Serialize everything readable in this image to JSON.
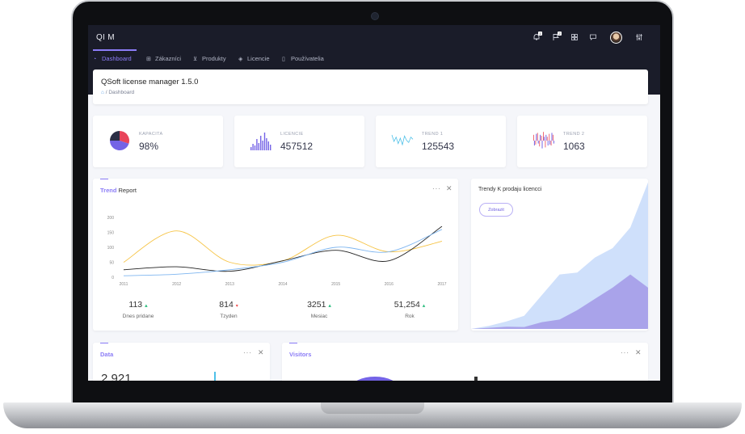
{
  "app": {
    "brand": "QI M"
  },
  "topbar": {
    "icons": [
      "bell-icon",
      "flag-icon",
      "grid-icon",
      "chat-icon",
      "avatar",
      "sliders-icon"
    ],
    "bell_badge": "1",
    "flag_badge": "2"
  },
  "nav": {
    "items": [
      {
        "label": "Dashboard",
        "icon": "gauge-icon",
        "active": true
      },
      {
        "label": "Zákazníci",
        "icon": "grid-icon"
      },
      {
        "label": "Produkty",
        "icon": "cart-icon"
      },
      {
        "label": "Licencie",
        "icon": "layers-icon"
      },
      {
        "label": "Používatelia",
        "icon": "file-icon"
      }
    ]
  },
  "page": {
    "title": "QSoft license manager 1.5.0",
    "breadcrumb": "Dashboard"
  },
  "stats": [
    {
      "label": "KAPACITA",
      "value": "98%"
    },
    {
      "label": "LICENCIE",
      "value": "457512"
    },
    {
      "label": "TREND 1",
      "value": "125543"
    },
    {
      "label": "TREND 2",
      "value": "1063"
    }
  ],
  "trend_card": {
    "title_accent": "Trend",
    "title_rest": " Report",
    "summary": [
      {
        "value": "113",
        "trend": "up",
        "caption": "Dnes pridane"
      },
      {
        "value": "814",
        "trend": "down",
        "caption": "Tzyden"
      },
      {
        "value": "3251",
        "trend": "up",
        "caption": "Mesiac"
      },
      {
        "value": "51,254",
        "trend": "up",
        "caption": "Rok"
      }
    ]
  },
  "right_card": {
    "title": "Trendy K prodaju licencci",
    "button": "Zobrazit"
  },
  "data_card": {
    "title": "Data",
    "value": "2,921"
  },
  "visitors_card": {
    "title": "Visitors"
  },
  "colors": {
    "accent": "#8b7cf6",
    "dark": "#1a1c29"
  },
  "chart_data": [
    {
      "type": "line",
      "x": [
        "2011",
        "2012",
        "2013",
        "2014",
        "2015",
        "2016",
        "2017"
      ],
      "yticks": [
        "200",
        "150",
        "100",
        "50",
        "0"
      ],
      "ylim": [
        0,
        200
      ],
      "series": [
        {
          "color": "#f6c343",
          "values": [
            50,
            155,
            50,
            55,
            140,
            85,
            120
          ]
        },
        {
          "color": "#222222",
          "values": [
            25,
            35,
            20,
            55,
            90,
            55,
            170
          ]
        },
        {
          "color": "#7fb6f0",
          "values": [
            5,
            10,
            25,
            50,
            100,
            85,
            160
          ]
        }
      ]
    },
    {
      "type": "area",
      "series": [
        {
          "color": "#cfe0fb",
          "values": [
            0,
            8,
            20,
            35,
            90,
            145,
            150,
            190,
            215,
            270,
            390
          ]
        },
        {
          "color": "#a9a3ea",
          "values": [
            0,
            3,
            6,
            5,
            18,
            25,
            50,
            80,
            110,
            145,
            110
          ]
        }
      ]
    },
    {
      "type": "bar",
      "series": [
        {
          "color": "#7463e6",
          "values": [
            4,
            8,
            6,
            14,
            9,
            18,
            12,
            22,
            15,
            11,
            7
          ]
        }
      ]
    },
    {
      "type": "bar",
      "series": [
        {
          "color": "#ef6a78",
          "values": [
            6,
            -4,
            8,
            -6,
            5,
            9,
            -7,
            4,
            7,
            -5,
            6
          ]
        },
        {
          "color": "#7463e6",
          "values": [
            -5,
            7,
            -3,
            6,
            -8,
            4,
            6,
            -5,
            -4,
            8,
            -3
          ]
        }
      ]
    },
    {
      "type": "line",
      "series": [
        {
          "color": "#4ec0e8",
          "values": [
            12,
            6,
            10,
            4,
            9,
            3,
            11,
            7,
            5,
            10,
            8
          ]
        }
      ]
    },
    {
      "type": "pie",
      "series": [
        {
          "color": "#e8445a",
          "values": [
            30
          ]
        },
        {
          "color": "#7463e6",
          "values": [
            45
          ]
        },
        {
          "color": "#2b2e45",
          "values": [
            25
          ]
        }
      ]
    }
  ]
}
